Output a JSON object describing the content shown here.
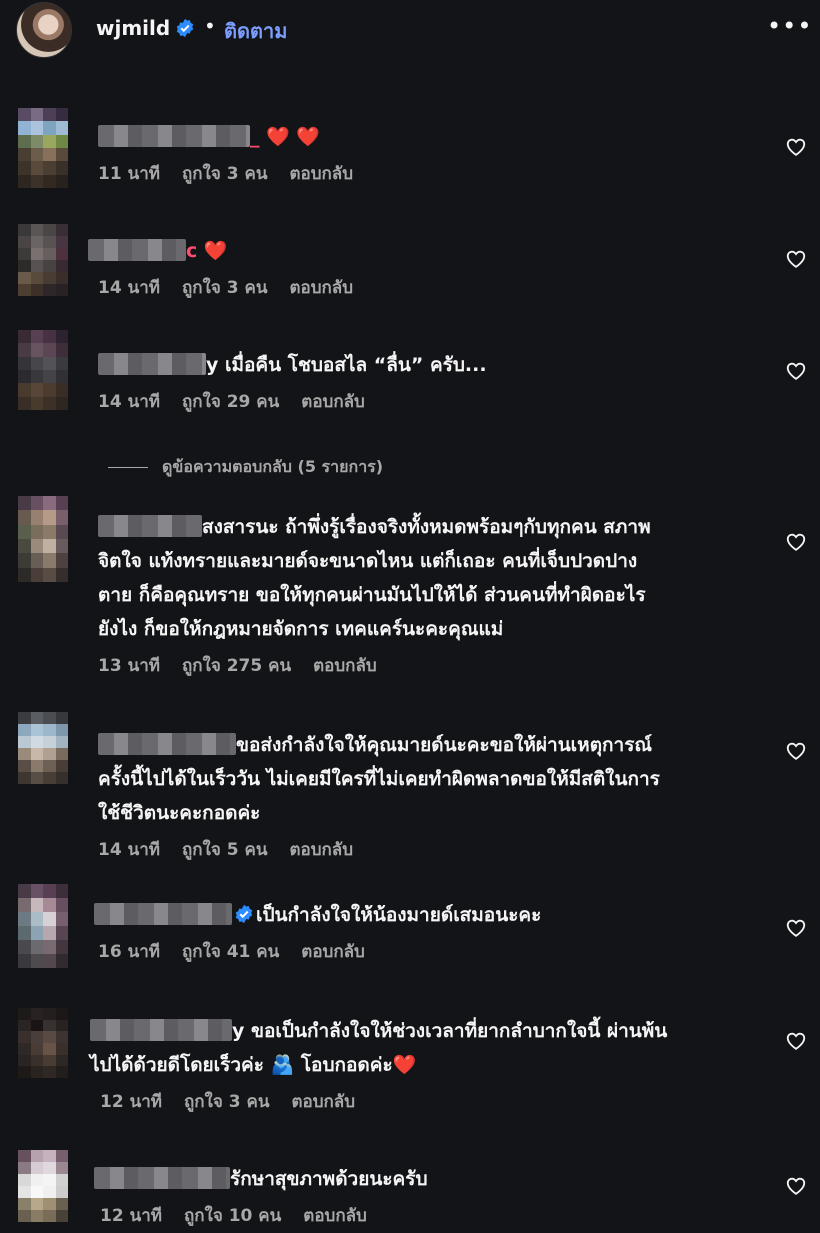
{
  "header": {
    "username": "wjmild",
    "separator": "•",
    "follow_label": "ติดตาม",
    "more_label": "•••"
  },
  "comments": [
    {
      "text_after": "_ ❤️ ❤️",
      "time": "11 นาที",
      "likes": "ถูกใจ 3 คน",
      "reply": "ตอบกลับ"
    },
    {
      "text_after": "c ❤️",
      "time": "14 นาที",
      "likes": "ถูกใจ 3 คน",
      "reply": "ตอบกลับ"
    },
    {
      "text_after": "y เมื่อคืน โชบอสไล “ลื่น” ครับ...",
      "time": "14 นาที",
      "likes": "ถูกใจ 29 คน",
      "reply": "ตอบกลับ"
    },
    {
      "text_after": "สงสารนะ ถ้าพึ่งรู้เรื่องจริงทั้งหมดพร้อมๆกับทุกคน สภาพ\nจิตใจ แท้งทรายและมายด์จะขนาดไหน แต่ก็เถอะ คนที่เจ็บปวดปาง\nตาย ก็คือคุณทราย ขอให้ทุกคนผ่านมันไปให้ได้ ส่วนคนที่ทำผิดอะไร\nยังไง ก็ขอให้กฎหมายจัดการ เทคแคร์นะคะคุณแม่",
      "time": "13 นาที",
      "likes": "ถูกใจ 275 คน",
      "reply": "ตอบกลับ"
    },
    {
      "text_after": "ขอส่งกำลังใจให้คุณมายด์นะคะขอให้ผ่านเหตุการณ์\nครั้งนี้ไปได้ในเร็ววัน ไม่เคยมีใครที่ไม่เคยทำผิดพลาดขอให้มีสติในการ\nใช้ชีวิตนะคะกอดค่ะ",
      "time": "14 นาที",
      "likes": "ถูกใจ 5 คน",
      "reply": "ตอบกลับ"
    },
    {
      "text_after": "เป็นกำลังใจให้น้องมายด์เสมอนะคะ",
      "time": "16 นาที",
      "likes": "ถูกใจ 41 คน",
      "reply": "ตอบกลับ"
    },
    {
      "text_after": "y ขอเป็นกำลังใจให้ช่วงเวลาที่ยากลำบากใจนี้ ผ่านพ้น\nไปได้ด้วยดีโดยเร็วค่ะ 🫂 โอบกอดค่ะ❤️",
      "time": "12 นาที",
      "likes": "ถูกใจ 3 คน",
      "reply": "ตอบกลับ"
    },
    {
      "text_after": "รักษาสุขภาพด้วยนะครับ",
      "time": "12 นาที",
      "likes": "ถูกใจ 10 คน",
      "reply": "ตอบกลับ"
    }
  ],
  "view_replies": "ดูข้อความตอบกลับ (5 รายการ)",
  "icons": {
    "verified": "verified-badge-icon",
    "heart": "heart-outline-icon",
    "more": "more-horizontal-icon"
  },
  "colors": {
    "background": "#131417",
    "accent": "#7b9dff",
    "verified": "#2d8cff",
    "muted": "#a8a8a8"
  }
}
